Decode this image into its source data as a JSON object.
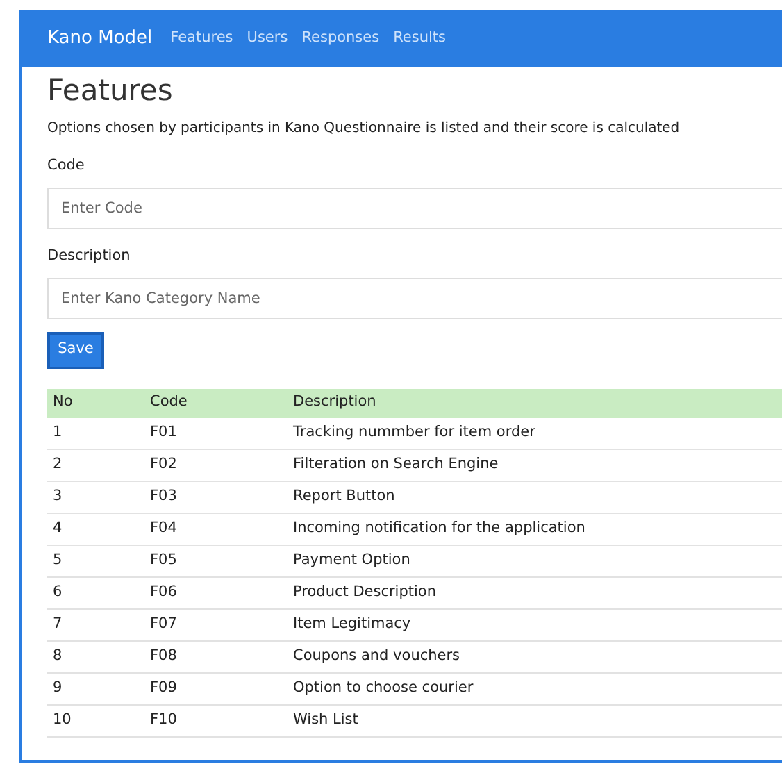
{
  "navbar": {
    "brand": "Kano Model",
    "links": [
      {
        "label": "Features"
      },
      {
        "label": "Users"
      },
      {
        "label": "Responses"
      },
      {
        "label": "Results"
      }
    ]
  },
  "page": {
    "title": "Features",
    "description": "Options chosen by participants in Kano Questionnaire is listed and their score is calculated"
  },
  "form": {
    "fields": [
      {
        "label": "Code",
        "placeholder": "Enter Code"
      },
      {
        "label": "Description",
        "placeholder": "Enter Kano Category Name"
      }
    ],
    "button": "Save"
  },
  "table": {
    "columns": [
      "No",
      "Code",
      "Description"
    ],
    "rows": [
      [
        "1",
        "F01",
        "Tracking nummber for item order"
      ],
      [
        "2",
        "F02",
        "Filteration on Search Engine"
      ],
      [
        "3",
        "F03",
        "Report Button"
      ],
      [
        "4",
        "F04",
        "Incoming notification for the application"
      ],
      [
        "5",
        "F05",
        "Payment Option"
      ],
      [
        "6",
        "F06",
        "Product Description"
      ],
      [
        "7",
        "F07",
        "Item Legitimacy"
      ],
      [
        "8",
        "F08",
        "Coupons and vouchers"
      ],
      [
        "9",
        "F09",
        "Option to choose courier"
      ],
      [
        "10",
        "F10",
        "Wish List"
      ]
    ]
  }
}
